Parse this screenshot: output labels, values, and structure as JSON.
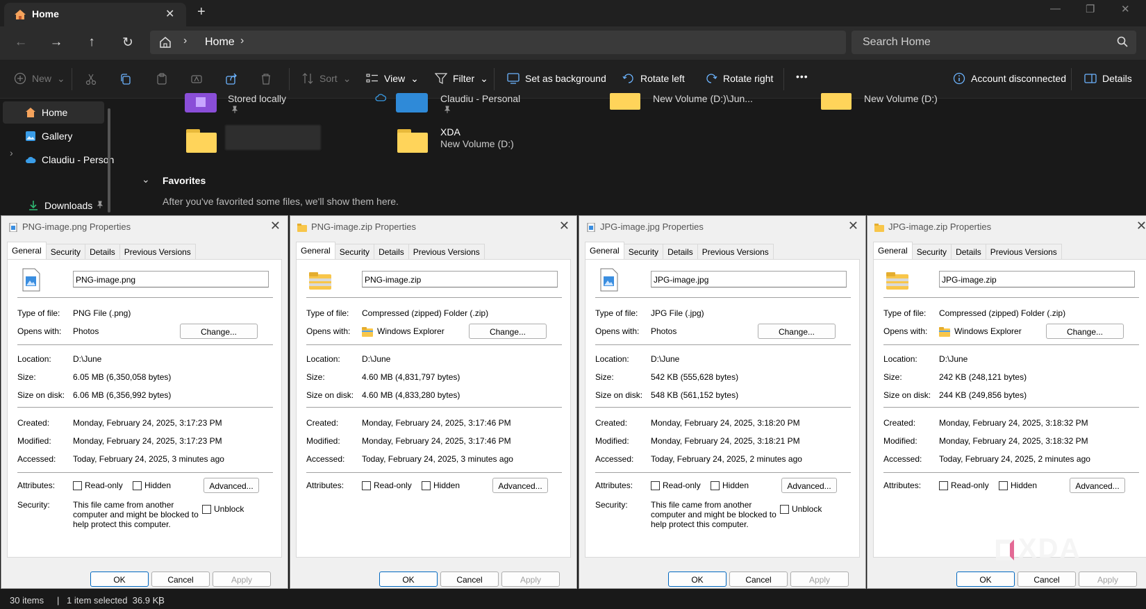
{
  "window": {
    "tab_title": "Home",
    "tab_close": "✕",
    "new_tab": "+",
    "minimize": "—",
    "restore": "❐",
    "close": "✕"
  },
  "nav": {
    "back": "←",
    "forward": "→",
    "up": "↑",
    "refresh": "↻",
    "sep1": "›",
    "crumb": "Home",
    "sep2": "›",
    "search_placeholder": "Search Home"
  },
  "toolbar": {
    "new_label": "New",
    "sort_label": "Sort",
    "view_label": "View",
    "filter_label": "Filter",
    "set_background": "Set as background",
    "rotate_left": "Rotate left",
    "rotate_right": "Rotate right",
    "more": "•••",
    "account": "Account disconnected",
    "details": "Details",
    "chevron": "⌄"
  },
  "sidebar": {
    "items": [
      {
        "label": "Home"
      },
      {
        "label": "Gallery"
      },
      {
        "label": "Claudiu - Person"
      },
      {
        "label": "Downloads"
      }
    ],
    "expand": "›"
  },
  "content": {
    "quick": [
      {
        "title": "Stored locally"
      },
      {
        "title": "Claudiu - Personal"
      },
      {
        "title": "New Volume (D:)\\Jun..."
      },
      {
        "title": "New Volume (D:)"
      }
    ],
    "xda_title": "XDA",
    "xda_sub": "New Volume (D:)",
    "favorites_title": "Favorites",
    "favorites_chevron": "⌄",
    "favorites_text": "After you've favorited some files, we'll show them here."
  },
  "status": {
    "items": "30 items",
    "sep": "|",
    "selected": "1 item selected  36.9 KB",
    "sep2": "|"
  },
  "dialog_common": {
    "tabs": [
      "General",
      "Security",
      "Details",
      "Previous Versions"
    ],
    "type_label": "Type of file:",
    "opens_label": "Opens with:",
    "change": "Change...",
    "location_label": "Location:",
    "size_label": "Size:",
    "disk_label": "Size on disk:",
    "created_label": "Created:",
    "modified_label": "Modified:",
    "accessed_label": "Accessed:",
    "attributes_label": "Attributes:",
    "readonly": "Read-only",
    "hidden": "Hidden",
    "advanced": "Advanced...",
    "security_label": "Security:",
    "security_text": "This file came from another computer and might be blocked to help protect this computer.",
    "unblock": "Unblock",
    "ok": "OK",
    "cancel": "Cancel",
    "apply": "Apply",
    "close": "✕"
  },
  "dialogs": [
    {
      "title": "PNG-image.png Properties",
      "name": "PNG-image.png",
      "type": "PNG File (.png)",
      "opens": "Photos",
      "location": "D:\\June",
      "size": "6.05 MB (6,350,058 bytes)",
      "disk": "6.06 MB (6,356,992 bytes)",
      "created": "Monday, February 24, 2025, 3:17:23 PM",
      "modified": "Monday, February 24, 2025, 3:17:23 PM",
      "accessed": "Today, February 24, 2025, 3 minutes ago"
    },
    {
      "title": "PNG-image.zip Properties",
      "name": "PNG-image.zip",
      "type": "Compressed (zipped) Folder (.zip)",
      "opens": "Windows Explorer",
      "location": "D:\\June",
      "size": "4.60 MB (4,831,797 bytes)",
      "disk": "4.60 MB (4,833,280 bytes)",
      "created": "Monday, February 24, 2025, 3:17:46 PM",
      "modified": "Monday, February 24, 2025, 3:17:46 PM",
      "accessed": "Today, February 24, 2025, 3 minutes ago"
    },
    {
      "title": "JPG-image.jpg Properties",
      "name": "JPG-image.jpg",
      "type": "JPG File (.jpg)",
      "opens": "Photos",
      "location": "D:\\June",
      "size": "542 KB (555,628 bytes)",
      "disk": "548 KB (561,152 bytes)",
      "created": "Monday, February 24, 2025, 3:18:20 PM",
      "modified": "Monday, February 24, 2025, 3:18:21 PM",
      "accessed": "Today, February 24, 2025, 2 minutes ago"
    },
    {
      "title": "JPG-image.zip Properties",
      "name": "JPG-image.zip",
      "type": "Compressed (zipped) Folder (.zip)",
      "opens": "Windows Explorer",
      "location": "D:\\June",
      "size": "242 KB (248,121 bytes)",
      "disk": "244 KB (249,856 bytes)",
      "created": "Monday, February 24, 2025, 3:18:32 PM",
      "modified": "Monday, February 24, 2025, 3:18:32 PM",
      "accessed": "Today, February 24, 2025, 2 minutes ago"
    }
  ],
  "watermark": "XDA",
  "colors": {
    "folder": "#ffd45a",
    "accent": "#0067c0",
    "onedrive": "#3a9de8"
  }
}
